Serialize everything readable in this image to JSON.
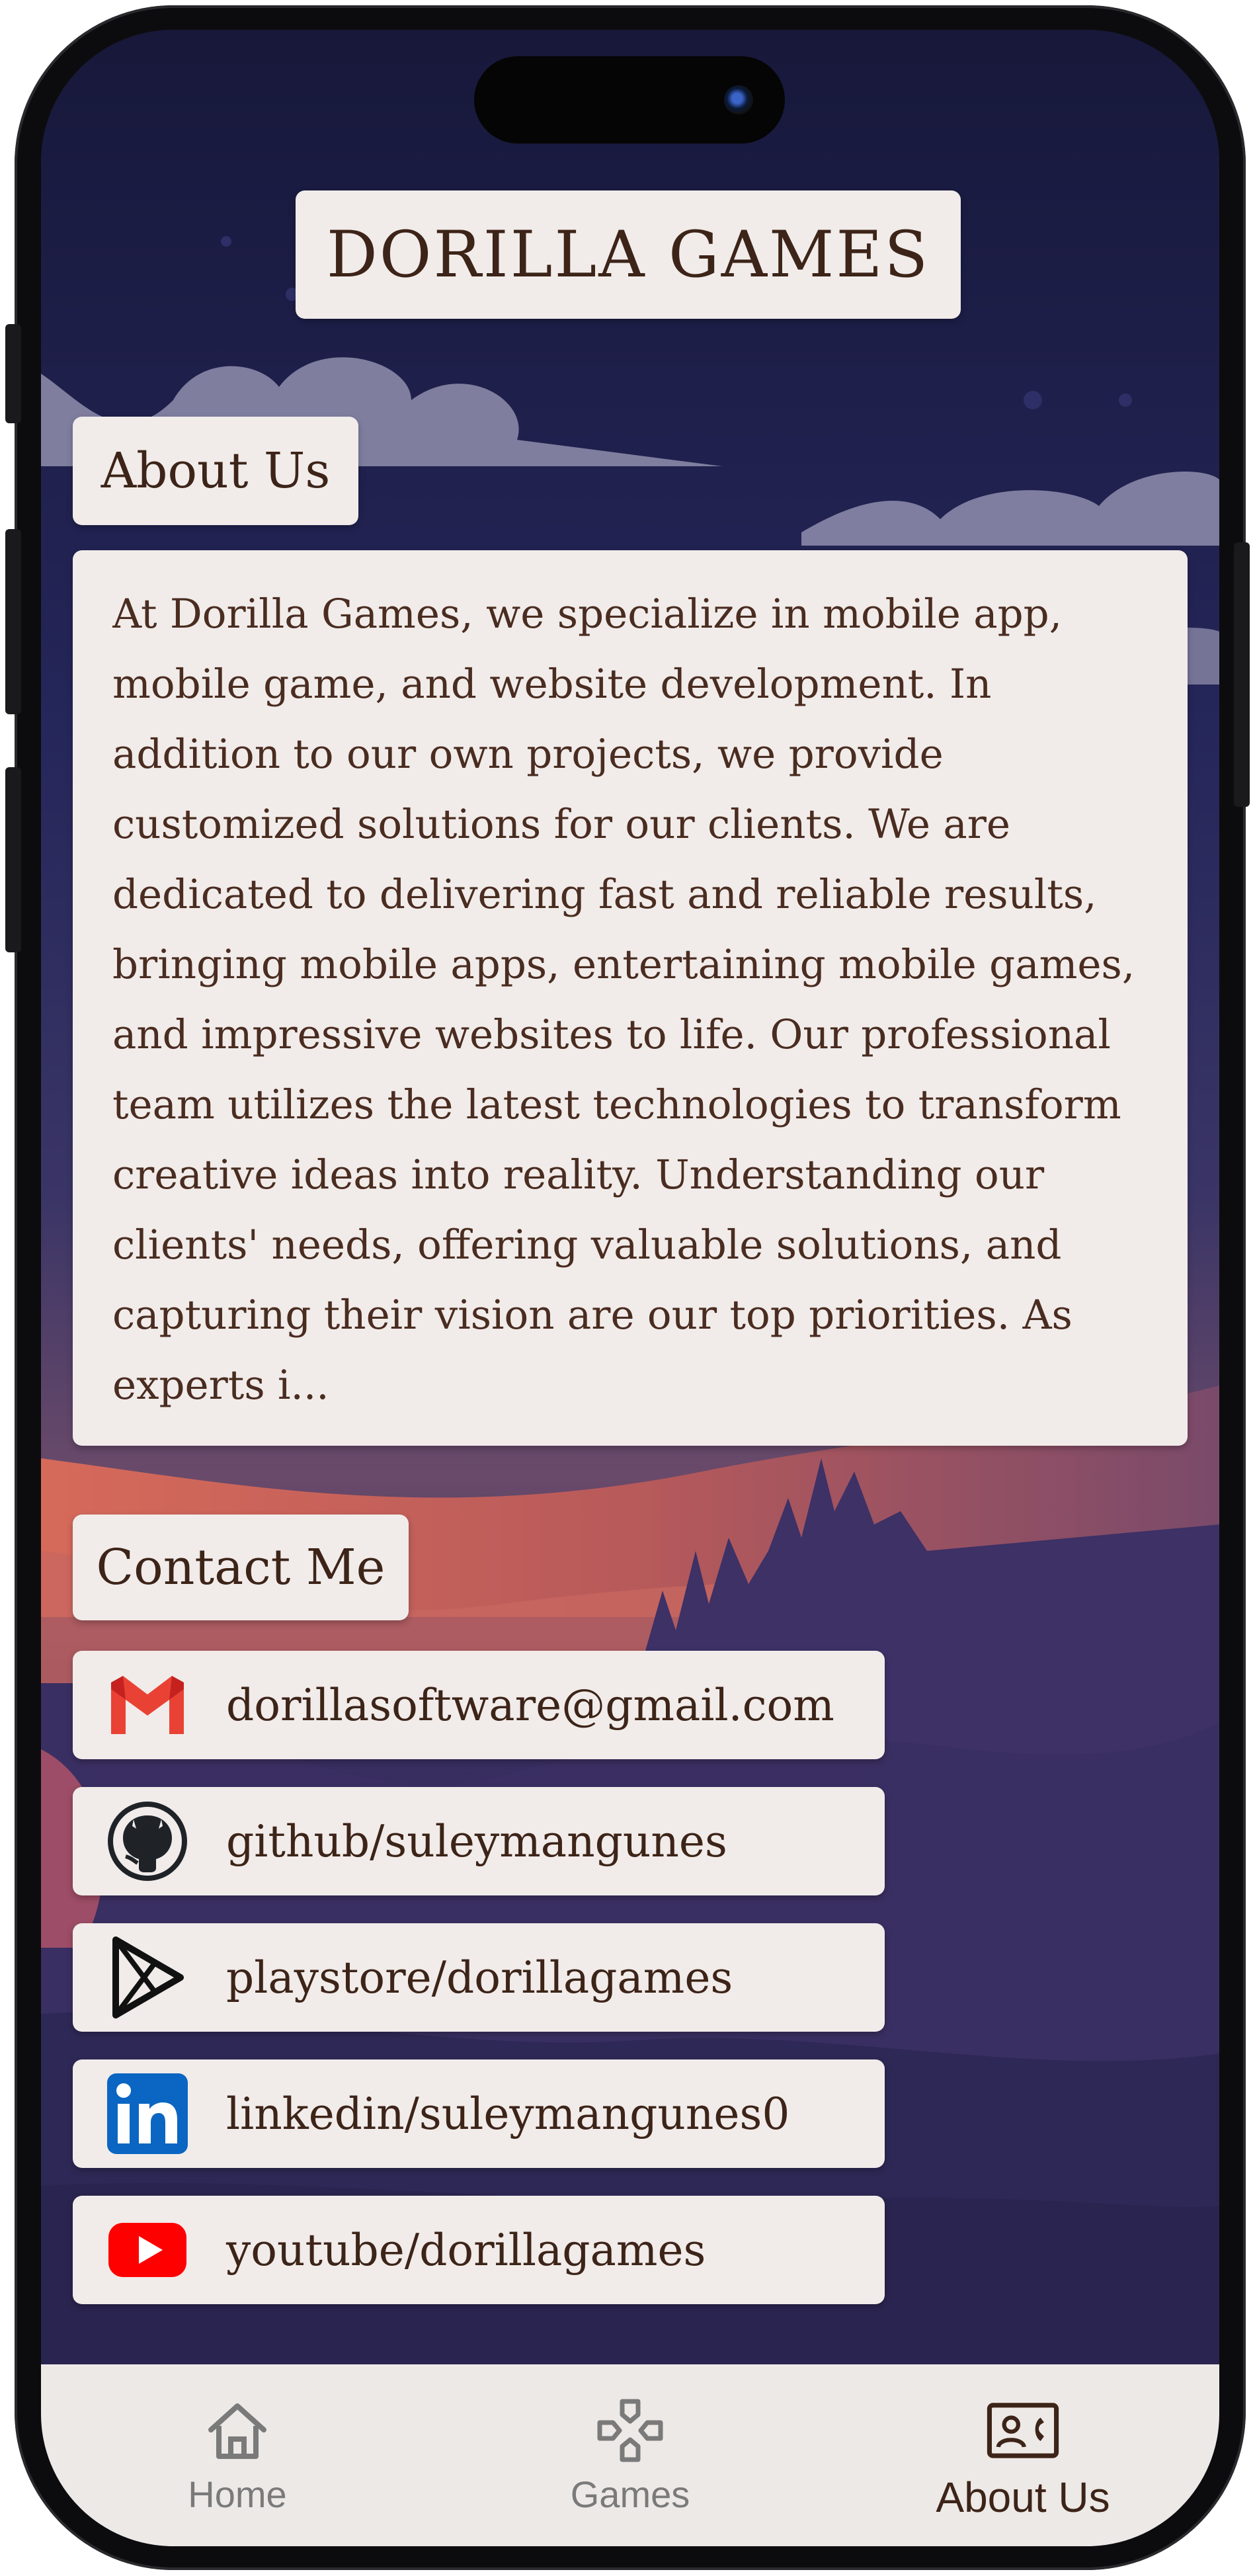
{
  "brand": {
    "title": "DORILLA GAMES"
  },
  "about": {
    "title": "About Us",
    "text": "At Dorilla Games, we specialize in mobile app, mobile game, and website development. In addition to our own projects, we provide customized solutions for our clients. We are dedicated to delivering fast and reliable results, bringing mobile apps, entertaining mobile games, and impressive websites to life. Our professional team utilizes the latest technologies to transform creative ideas into reality. Understanding our clients' needs, offering valuable solutions, and capturing their vision are our top priorities. As experts i..."
  },
  "contact": {
    "title": "Contact Me",
    "items": [
      {
        "icon": "gmail-icon",
        "label": "dorillasoftware@gmail.com"
      },
      {
        "icon": "github-icon",
        "label": "github/suleymangunes"
      },
      {
        "icon": "playstore-icon",
        "label": "playstore/dorillagames"
      },
      {
        "icon": "linkedin-icon",
        "label": "linkedin/suleymangunes0"
      },
      {
        "icon": "youtube-icon",
        "label": "youtube/dorillagames"
      }
    ]
  },
  "nav": {
    "items": [
      {
        "icon": "home-icon",
        "label": "Home"
      },
      {
        "icon": "gamepad-icon",
        "label": "Games"
      },
      {
        "icon": "contact-card-icon",
        "label": "About Us"
      }
    ],
    "active": "About Us"
  },
  "colors": {
    "card": "#f1ecea",
    "text": "#3d2418",
    "sky_top": "#1a1a3c",
    "sky_mid": "#2c2b5e",
    "sunset": "#d46a52",
    "mountain": "#3e3168",
    "navbar": "#ede9e7"
  }
}
